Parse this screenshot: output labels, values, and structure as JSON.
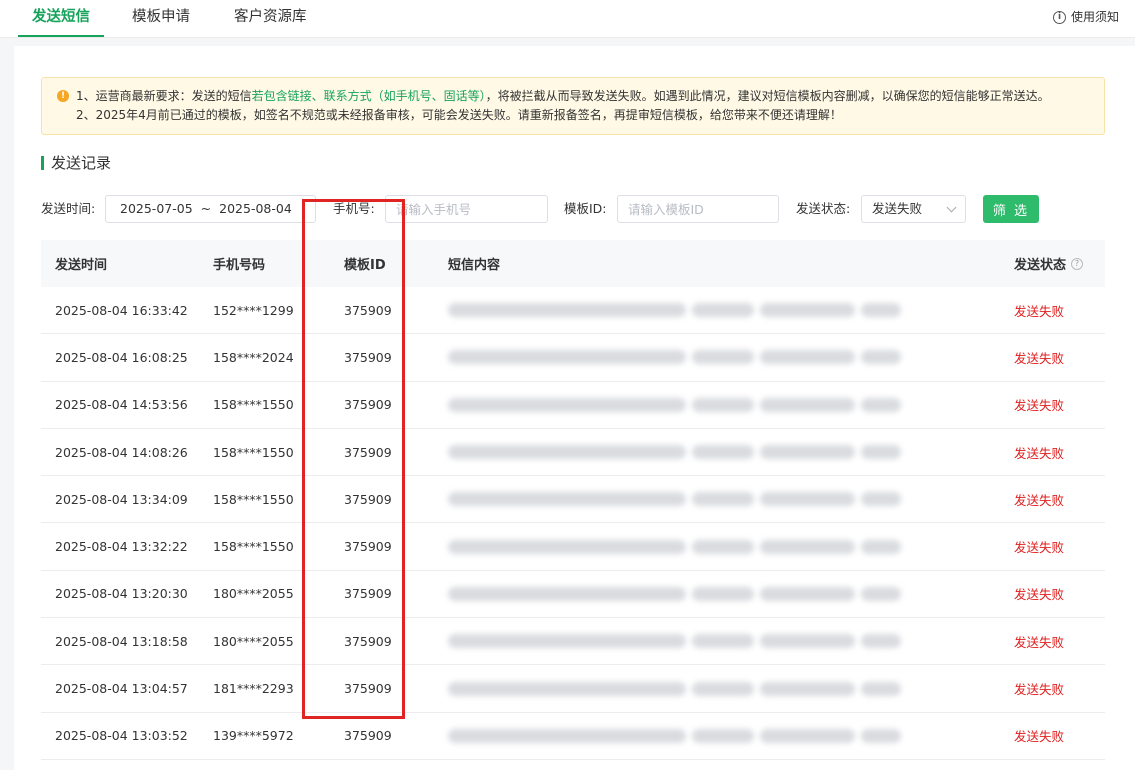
{
  "tabs": [
    {
      "label": "发送短信",
      "active": true
    },
    {
      "label": "模板申请",
      "active": false
    },
    {
      "label": "客户资源库",
      "active": false
    }
  ],
  "help": {
    "label": "使用须知",
    "icon": "info-icon"
  },
  "notice": {
    "icon": "warning-icon",
    "line1_pre": "1、运营商最新要求：发送的短信",
    "line1_highlight": "若包含链接、联系方式（如手机号、固话等）",
    "line1_post": "，将被拦截从而导致发送失败。如遇到此情况，建议对短信模板内容删减，以确保您的短信能够正常送达。",
    "line2": "2、2025年4月前已通过的模板，如签名不规范或未经报备审核，可能会发送失败。请重新报备签名，再提审短信模板，给您带来不便还请理解！"
  },
  "section_title": "发送记录",
  "filters": {
    "time_label": "发送时间:",
    "date_start": "2025-07-05",
    "date_sep": "~",
    "date_end": "2025-08-04",
    "phone_label": "手机号:",
    "phone_placeholder": "请输入手机号",
    "template_label": "模板ID:",
    "template_placeholder": "请输入模板ID",
    "status_label": "发送状态:",
    "status_value": "发送失败",
    "filter_button": "筛 选"
  },
  "table": {
    "headers": {
      "time": "发送时间",
      "phone": "手机号码",
      "template_id": "模板ID",
      "content": "短信内容",
      "status": "发送状态"
    },
    "rows": [
      {
        "time": "2025-08-04 16:33:42",
        "phone": "152****1299",
        "template_id": "375909",
        "status": "发送失败"
      },
      {
        "time": "2025-08-04 16:08:25",
        "phone": "158****2024",
        "template_id": "375909",
        "status": "发送失败"
      },
      {
        "time": "2025-08-04 14:53:56",
        "phone": "158****1550",
        "template_id": "375909",
        "status": "发送失败"
      },
      {
        "time": "2025-08-04 14:08:26",
        "phone": "158****1550",
        "template_id": "375909",
        "status": "发送失败"
      },
      {
        "time": "2025-08-04 13:34:09",
        "phone": "158****1550",
        "template_id": "375909",
        "status": "发送失败"
      },
      {
        "time": "2025-08-04 13:32:22",
        "phone": "158****1550",
        "template_id": "375909",
        "status": "发送失败"
      },
      {
        "time": "2025-08-04 13:20:30",
        "phone": "180****2055",
        "template_id": "375909",
        "status": "发送失败"
      },
      {
        "time": "2025-08-04 13:18:58",
        "phone": "180****2055",
        "template_id": "375909",
        "status": "发送失败"
      },
      {
        "time": "2025-08-04 13:04:57",
        "phone": "181****2293",
        "template_id": "375909",
        "status": "发送失败"
      },
      {
        "time": "2025-08-04 13:03:52",
        "phone": "139****5972",
        "template_id": "375909",
        "status": "发送失败"
      }
    ]
  },
  "colors": {
    "accent": "#17a35b",
    "button": "#2fbb6c",
    "fail": "#e02020",
    "highlight_frame": "#e02424",
    "notice_bg": "#fff9e6"
  }
}
